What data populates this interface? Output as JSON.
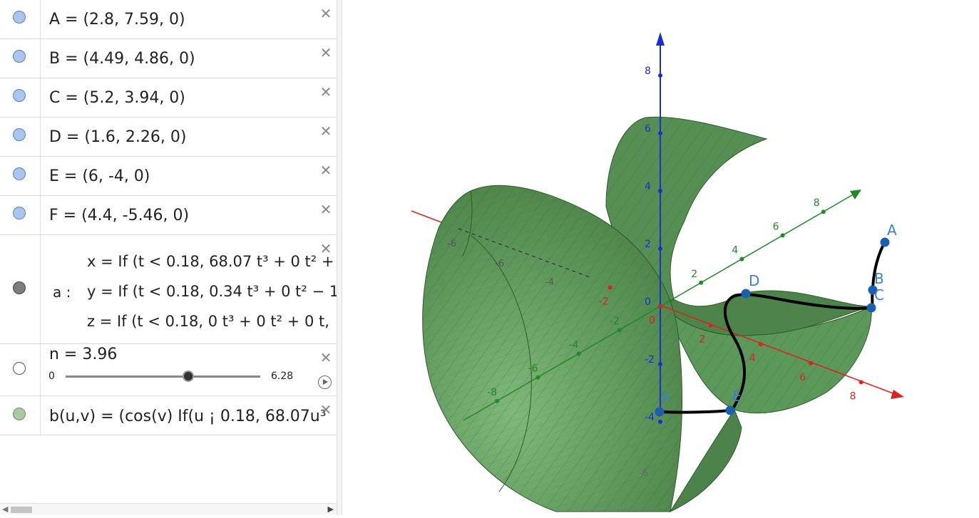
{
  "algebra": {
    "points": [
      {
        "label": "A = (2.8, 7.59, 0)"
      },
      {
        "label": "B = (4.49, 4.86, 0)"
      },
      {
        "label": "C = (5.2, 3.94, 0)"
      },
      {
        "label": "D = (1.6, 2.26, 0)"
      },
      {
        "label": "E = (6, -4, 0)"
      },
      {
        "label": "F = (4.4, -5.46, 0)"
      }
    ],
    "curve": {
      "name": "a :",
      "x": "x = If (t < 0.18, 68.07 t³ + 0 t² +",
      "y": "y = If (t < 0.18, 0.34 t³ + 0 t² − 1",
      "z": "z = If (t < 0.18, 0 t³ + 0 t² + 0 t,"
    },
    "slider": {
      "label": "n = 3.96",
      "min": "0",
      "max": "6.28",
      "value": 3.96,
      "range_min": 0,
      "range_max": 6.28
    },
    "surface": {
      "label": "b(u,v) = (cos(v) If(u ¡ 0.18, 68.07u³"
    },
    "close_glyph": "✕"
  },
  "graphics": {
    "x_ticks": [
      "-2",
      "0",
      "2",
      "4",
      "6",
      "8"
    ],
    "y_ticks": [
      "-8",
      "-6",
      "-4",
      "-2",
      "2",
      "4",
      "6",
      "8"
    ],
    "z_ticks": [
      "-4",
      "-2",
      "0",
      "2",
      "4",
      "6",
      "8"
    ],
    "back_ticks": [
      "-6",
      "-4",
      "-8"
    ],
    "point_labels": [
      "A",
      "B",
      "C",
      "D",
      "E",
      "F"
    ],
    "bottom_label": "-6",
    "colors": {
      "x_axis": "#dd2222",
      "y_axis": "#22882a",
      "z_axis": "#1a2fd0",
      "surface": "#5d9a5a",
      "surface_dark": "#3f6d3e",
      "point": "#1a5fb0",
      "point_label": "#3b7fd0"
    }
  }
}
